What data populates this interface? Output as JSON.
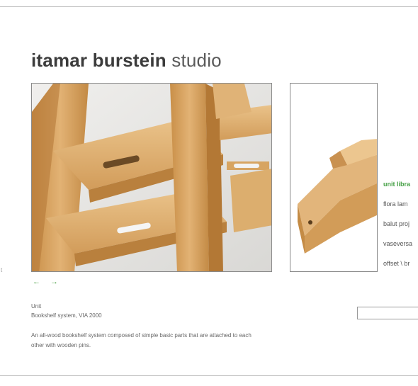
{
  "header": {
    "title_bold": "itamar burstein",
    "title_light": " studio"
  },
  "gallery": {
    "prev_arrow": "←",
    "next_arrow": "→",
    "main_image_alt": "Unit bookshelf close-up",
    "side_image_alt": "Unit wooden part"
  },
  "left_edge": {
    "text": "t"
  },
  "project": {
    "name": "Unit",
    "subtitle": "Bookshelf system, VIA 2000",
    "description": "An all-wood bookshelf system composed of simple basic parts that are attached to each other with wooden pins."
  },
  "nav": {
    "items": [
      {
        "label": "unit libra",
        "active": true
      },
      {
        "label": "flora lam",
        "active": false
      },
      {
        "label": "balut proj",
        "active": false
      },
      {
        "label": "vaseversa",
        "active": false
      },
      {
        "label": "offset \\ br",
        "active": false
      }
    ]
  },
  "search": {
    "value": ""
  },
  "colors": {
    "accent": "#45a045",
    "wood": "#d8a967",
    "text": "#555555"
  }
}
